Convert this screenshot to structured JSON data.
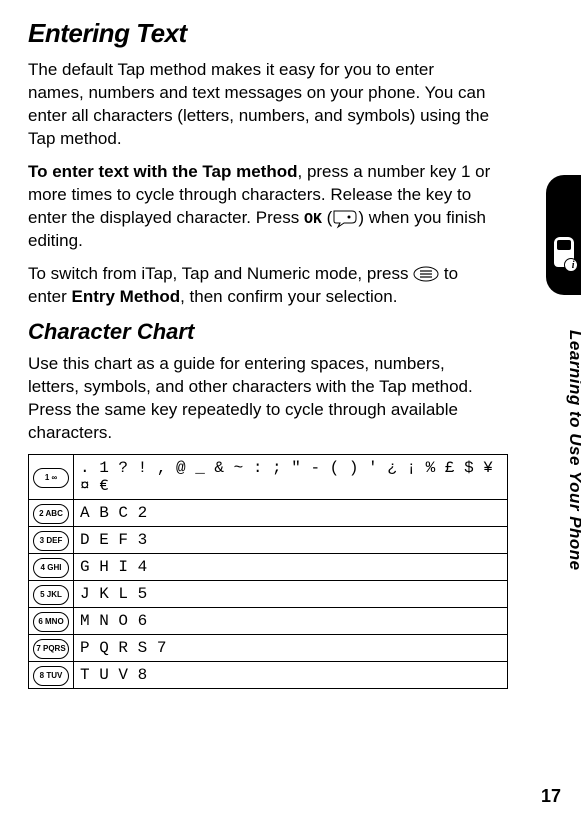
{
  "heading": "Entering Text",
  "intro": "The default Tap method makes it easy for you to enter names, numbers and text messages on your phone. You can enter all characters (letters, numbers, and symbols) using the Tap method.",
  "tap_lead_bold": "To enter text with the Tap method",
  "tap_lead_rest": ", press a number key 1 or more times to cycle through characters. Release the key to enter the displayed character. Press ",
  "ok_label": "OK",
  "tap_after_ok_open": " (",
  "tap_after_ok_close": ") when you finish editing.",
  "switch_text_a": "To switch from iTap, Tap and Numeric mode, press ",
  "switch_text_b": " to enter ",
  "entry_method_bold": "Entry Method",
  "switch_text_c": ", then confirm your selection.",
  "subheading": "Character Chart",
  "chart_intro": "Use this chart as a guide for entering spaces, numbers, letters, symbols, and other characters with the Tap method. Press the same key repeatedly to cycle through available characters.",
  "rows": [
    {
      "key": "1 ∞",
      "chars": ". 1 ? ! , @ _ & ~ : ; \" - ( ) ' ¿ ¡ % £ $ ¥ ¤ €"
    },
    {
      "key": "2 ABC",
      "chars": "A B C 2"
    },
    {
      "key": "3 DEF",
      "chars": "D E F 3"
    },
    {
      "key": "4 GHI",
      "chars": "G H I 4"
    },
    {
      "key": "5 JKL",
      "chars": "J K L 5"
    },
    {
      "key": "6 MNO",
      "chars": "M N O 6"
    },
    {
      "key": "7 PQRS",
      "chars": "P Q R S 7"
    },
    {
      "key": "8 TUV",
      "chars": "T U V 8"
    }
  ],
  "side_text": "Learning to Use Your Phone",
  "page_number": "17"
}
